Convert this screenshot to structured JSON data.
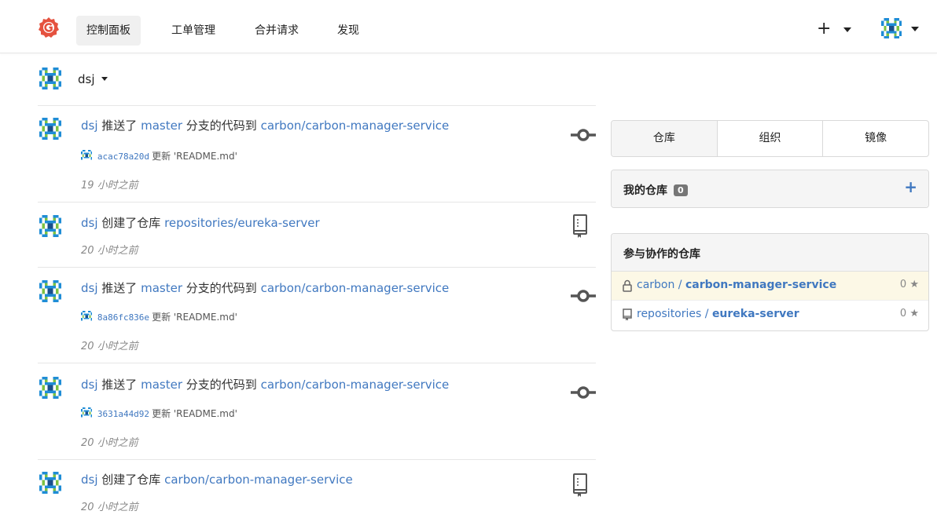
{
  "nav": {
    "items": [
      {
        "label": "控制面板",
        "active": true
      },
      {
        "label": "工单管理",
        "active": false
      },
      {
        "label": "合并请求",
        "active": false
      },
      {
        "label": "发现",
        "active": false
      }
    ],
    "plus_label": "+",
    "logo_icon": "gitea-logo",
    "brand_color": "#e5523f"
  },
  "context": {
    "username": "dsj"
  },
  "feed": [
    {
      "user": "dsj",
      "action": "推送了",
      "branch": "master",
      "mid": "分支的代码到",
      "repo": "carbon/carbon-manager-service",
      "commit_sha": "acac78a20d",
      "commit_msg": "更新 'README.md'",
      "time": "19 小时之前",
      "icon": "commit-icon"
    },
    {
      "user": "dsj",
      "action": "创建了仓库",
      "branch": "",
      "mid": "",
      "repo": "repositories/eureka-server",
      "commit_sha": "",
      "commit_msg": "",
      "time": "20 小时之前",
      "icon": "repo-icon"
    },
    {
      "user": "dsj",
      "action": "推送了",
      "branch": "master",
      "mid": "分支的代码到",
      "repo": "carbon/carbon-manager-service",
      "commit_sha": "8a86fc836e",
      "commit_msg": "更新 'README.md'",
      "time": "20 小时之前",
      "icon": "commit-icon"
    },
    {
      "user": "dsj",
      "action": "推送了",
      "branch": "master",
      "mid": "分支的代码到",
      "repo": "carbon/carbon-manager-service",
      "commit_sha": "3631a44d92",
      "commit_msg": "更新 'README.md'",
      "time": "20 小时之前",
      "icon": "commit-icon"
    },
    {
      "user": "dsj",
      "action": "创建了仓库",
      "branch": "",
      "mid": "",
      "repo": "carbon/carbon-manager-service",
      "commit_sha": "",
      "commit_msg": "",
      "time": "20 小时之前",
      "icon": "repo-icon"
    }
  ],
  "sidebar": {
    "tabs": [
      "仓库",
      "组织",
      "镜像"
    ],
    "my_repos": {
      "title": "我的仓库",
      "count": "0",
      "add_label": "+"
    },
    "collab": {
      "title": "参与协作的仓库",
      "repos": [
        {
          "owner": "carbon",
          "sep": " / ",
          "name": "carbon-manager-service",
          "stars": "0",
          "icon": "lock-icon"
        },
        {
          "owner": "repositories",
          "sep": " / ",
          "name": "eureka-server",
          "stars": "0",
          "icon": "book-icon"
        }
      ]
    },
    "star_glyph": "★"
  }
}
